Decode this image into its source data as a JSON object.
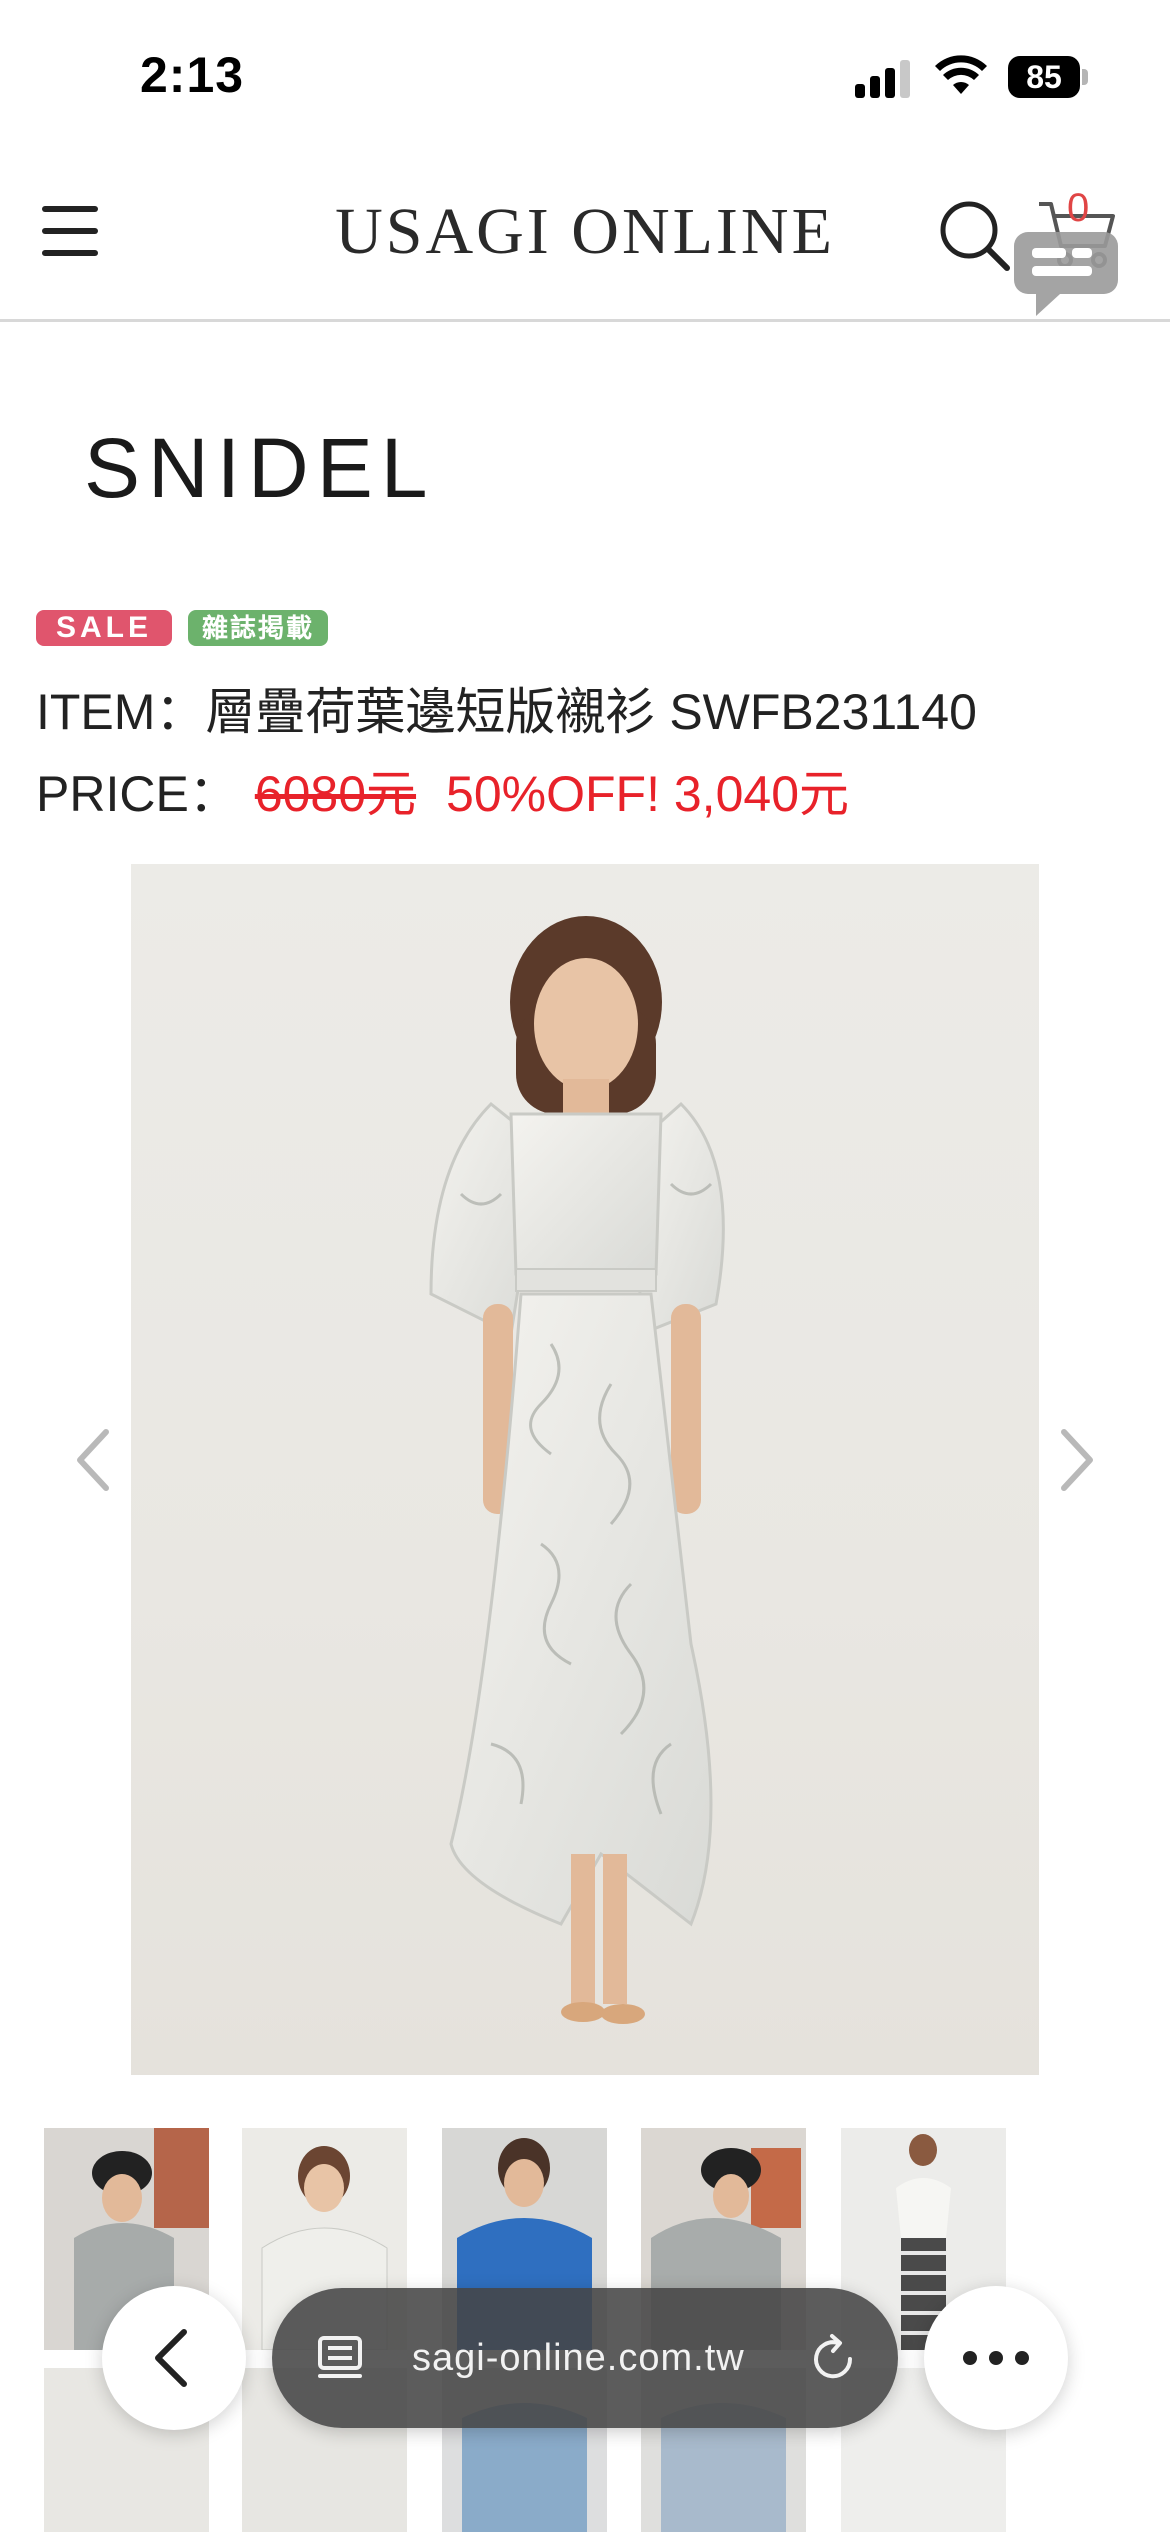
{
  "status_bar": {
    "time": "2:13",
    "battery_level": "85",
    "signal_bars_filled": 3,
    "signal_bars_total": 4
  },
  "header": {
    "logo": "USAGI ONLINE",
    "cart_count": "0",
    "menu_icon": "hamburger-menu-icon",
    "search_icon": "search-icon",
    "cart_icon": "shopping-cart-icon",
    "chat_icon": "chat-bubble-icon"
  },
  "product": {
    "brand": "SNIDEL",
    "badges": [
      "SALE",
      "雜誌掲載"
    ],
    "item_label": "ITEM：",
    "item_name": "層疊荷葉邊短版襯衫 SWFB231140",
    "price_label": "PRICE：",
    "original_price": "6080元",
    "sale_price": "50%OFF! 3,040元"
  },
  "carousel": {
    "prev_icon": "chevron-left-icon",
    "next_icon": "chevron-right-icon"
  },
  "browser": {
    "url": "sagi-online.com.tw",
    "back_icon": "chevron-left-icon",
    "tabs_icon": "tabs-icon",
    "reload_icon": "reload-icon",
    "more_icon": "more-icon"
  },
  "colors": {
    "sale_red": "#e8222a",
    "sale_badge": "#e0556d",
    "magazine_badge": "#6cb26c",
    "cart_count": "#e04545"
  }
}
